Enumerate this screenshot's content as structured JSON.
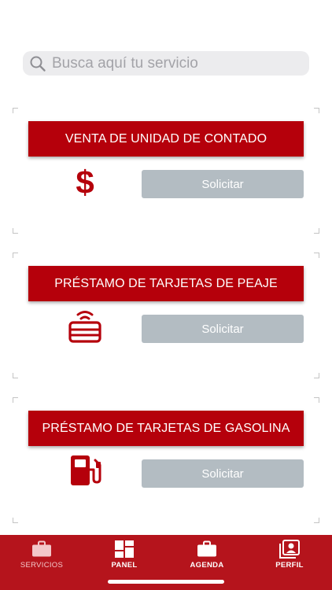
{
  "search": {
    "placeholder": "Busca aquí tu servicio",
    "icon": "search-icon"
  },
  "services": [
    {
      "title": "VENTA DE UNIDAD DE CONTADO",
      "icon": "dollar-icon",
      "button": "Solicitar"
    },
    {
      "title": "PRÉSTAMO DE TARJETAS DE PEAJE",
      "icon": "toll-card-icon",
      "button": "Solicitar"
    },
    {
      "title": "PRÉSTAMO DE TARJETAS DE GASOLINA",
      "icon": "fuel-pump-icon",
      "button": "Solicitar"
    }
  ],
  "tabbar": {
    "items": [
      {
        "label": "SERVICIOS",
        "icon": "briefcase-icon",
        "active": true
      },
      {
        "label": "PANEL",
        "icon": "dashboard-icon",
        "active": false
      },
      {
        "label": "AGENDA",
        "icon": "briefcase-icon",
        "active": false
      },
      {
        "label": "PERFIL",
        "icon": "profile-icon",
        "active": false
      }
    ]
  },
  "colors": {
    "brand_red": "#b5000b",
    "tabbar_red": "#b5141c",
    "button_gray": "#b3bcc2"
  }
}
